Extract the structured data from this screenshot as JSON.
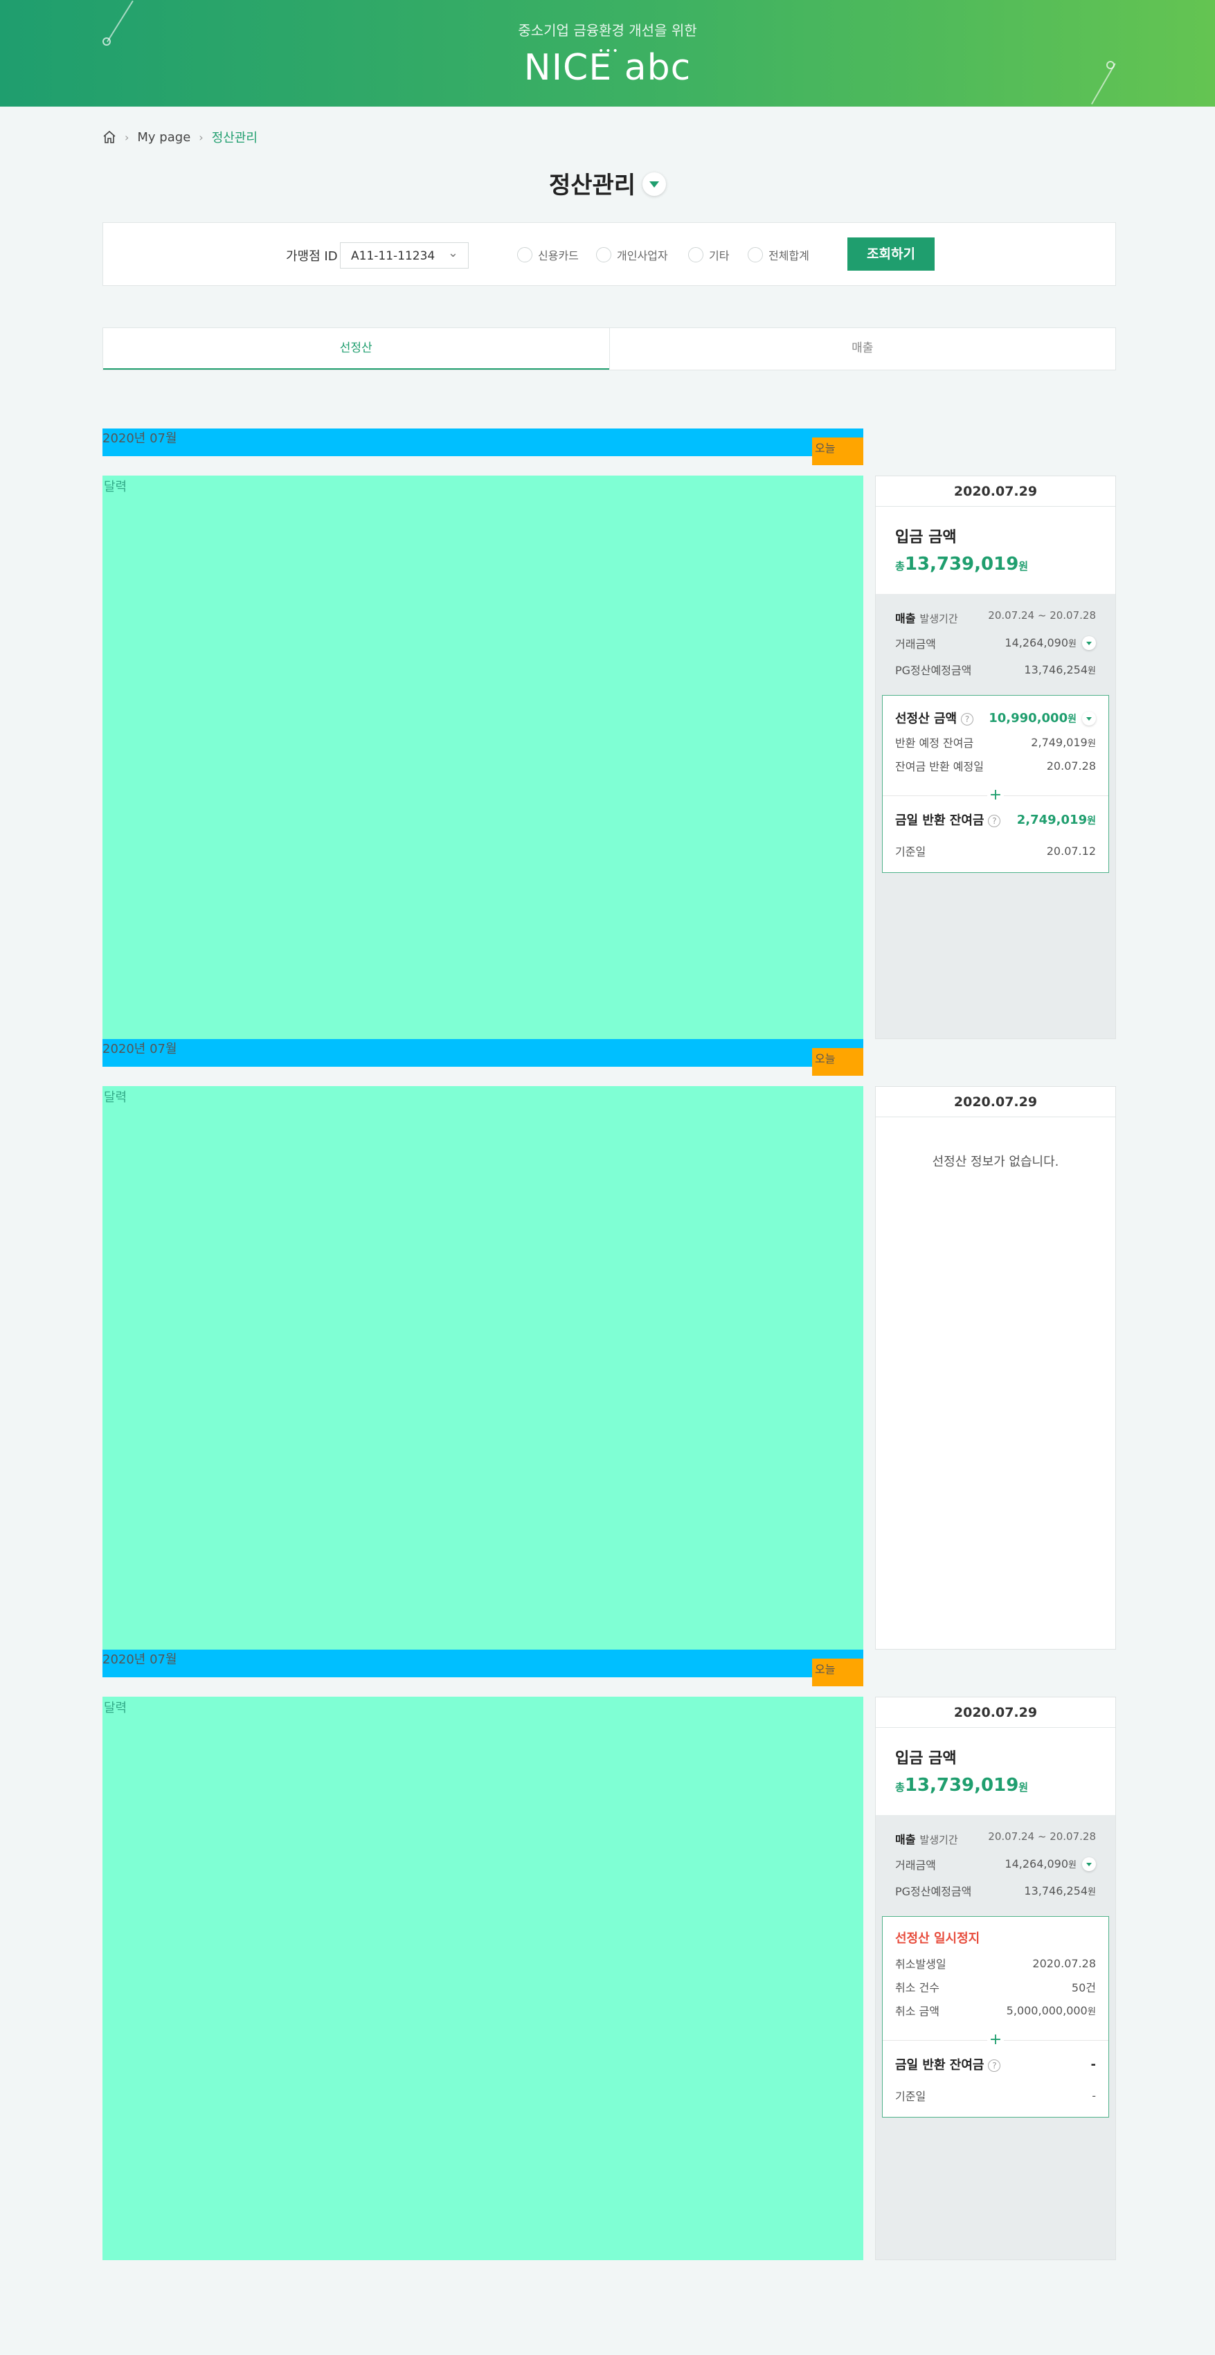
{
  "header": {
    "subtitle": "중소기업 금융환경 개선을 위한",
    "logo": "NICE abc",
    "dots": "•••"
  },
  "breadcrumb": {
    "home_icon": "home-icon",
    "sep": "›",
    "item1": "My page",
    "current": "정산관리"
  },
  "page_title": "정산관리",
  "filter": {
    "label": "가맹점 ID",
    "selected": "A11-11-11234",
    "radios": [
      "신용카드",
      "개인사업자",
      "기타",
      "전체합계"
    ],
    "search_button": "조회하기"
  },
  "tabs": [
    "선정산",
    "매출"
  ],
  "sections": [
    {
      "month": "2020년 07월",
      "today": "오늘",
      "calendar_label": "달력",
      "date": "2020.07.29",
      "deposit_title": "입금 금액",
      "deposit_prefix": "총",
      "deposit_amount": "13,739,019",
      "deposit_unit": "원",
      "sales_title": "매출",
      "period_label": "발생기간",
      "period": "20.07.24 ~ 20.07.28",
      "trade_label": "거래금액",
      "trade_amount": "14,264,090",
      "unit": "원",
      "pg_label": "PG정산예정금액",
      "pg_amount": "13,746,254",
      "box_title": "선정산 금액",
      "box_amount": "10,990,000",
      "r1_label": "반환 예정 잔여금",
      "r1_value": "2,749,019",
      "r2_label": "잔여금 반환 예정일",
      "r2_value": "20.07.28",
      "plus": "+",
      "b2_title": "금일 반환 잔여금",
      "b2_amount": "2,749,019",
      "b2_r_label": "기준일",
      "b2_r_value": "20.07.12"
    },
    {
      "month": "2020년 07월",
      "today": "오늘",
      "calendar_label": "달력",
      "date": "2020.07.29",
      "no_info": "선정산 정보가 없습니다."
    },
    {
      "month": "2020년 07월",
      "today": "오늘",
      "calendar_label": "달력",
      "date": "2020.07.29",
      "deposit_title": "입금 금액",
      "deposit_prefix": "총",
      "deposit_amount": "13,739,019",
      "deposit_unit": "원",
      "sales_title": "매출",
      "period_label": "발생기간",
      "period": "20.07.24 ~ 20.07.28",
      "trade_label": "거래금액",
      "trade_amount": "14,264,090",
      "unit": "원",
      "pg_label": "PG정산예정금액",
      "pg_amount": "13,746,254",
      "box_title": "선정산 일시정지",
      "r1_label": "취소발생일",
      "r1_value": "2020.07.28",
      "r2_label": "취소 건수",
      "r2_value": "50건",
      "r3_label": "취소 금액",
      "r3_value": "5,000,000,000",
      "plus": "+",
      "b2_title": "금일 반환 잔여금",
      "b2_amount": "-",
      "b2_r_label": "기준일",
      "b2_r_value": "-"
    }
  ]
}
